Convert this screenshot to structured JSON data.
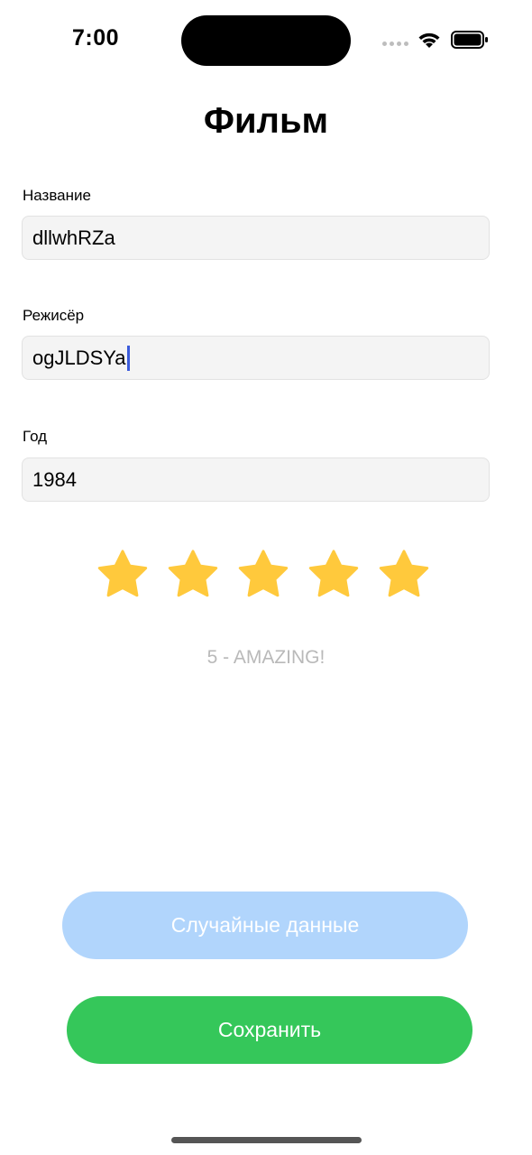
{
  "status_bar": {
    "time": "7:00"
  },
  "header": {
    "title": "Фильм"
  },
  "form": {
    "name": {
      "label": "Название",
      "value": "dllwhRZa"
    },
    "director": {
      "label": "Режисёр",
      "value": "ogJLDSYa"
    },
    "year": {
      "label": "Год",
      "value": "1984"
    }
  },
  "rating": {
    "stars": 5,
    "max": 5,
    "text": "5 - AMAZING!",
    "star_color": "#ffc93c"
  },
  "buttons": {
    "random": "Случайные данные",
    "save": "Сохранить"
  },
  "colors": {
    "random_button": "#b1d5fc",
    "save_button": "#35c75a",
    "caret": "#3b5bdb"
  }
}
